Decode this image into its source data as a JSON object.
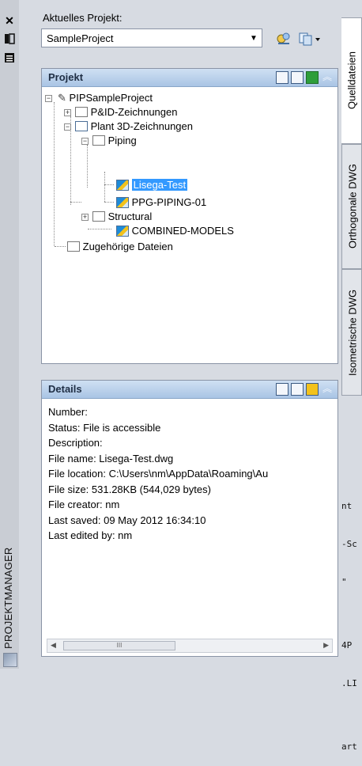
{
  "left_strip": {
    "close_symbol": "✕",
    "vertical_title": "PROJEKTMANAGER"
  },
  "project_selector": {
    "label": "Aktuelles Projekt:",
    "selected_value": "SampleProject"
  },
  "project_panel": {
    "title": "Projekt",
    "tree": [
      {
        "label": "PIPSampleProject"
      },
      {
        "label": "P&ID-Zeichnungen"
      },
      {
        "label": "Plant 3D-Zeichnungen"
      },
      {
        "label": "Piping"
      },
      {
        "label": "Lisega-Test",
        "selected": true
      },
      {
        "label": "PPG-PIPING-01"
      },
      {
        "label": "Structural"
      },
      {
        "label": "COMBINED-MODELS"
      },
      {
        "label": "Zugehörige Dateien"
      }
    ]
  },
  "details_panel": {
    "title": "Details",
    "lines": [
      "Number:",
      "Status: File is accessible",
      "Description:",
      "File name:  Lisega-Test.dwg",
      "File location:  C:\\Users\\nm\\AppData\\Roaming\\Au",
      "File size: 531.28KB (544,029 bytes)",
      "File creator: nm",
      "Last saved: 09 May 2012 16:34:10",
      "Last edited by: nm"
    ],
    "scroll_thumb_text": "III"
  },
  "right_tabs": [
    {
      "label": "Quelldateien",
      "active": true
    },
    {
      "label": "Orthogonale DWG",
      "active": false
    },
    {
      "label": "Isometrische DWG",
      "active": false
    }
  ],
  "background_code_lines": [
    "nt",
    "-Sc",
    "\"",
    "",
    "4P",
    ".LI",
    "",
    "art"
  ],
  "colors": {
    "selection": "#3399ff",
    "panel_header": "#a9c4e4"
  }
}
